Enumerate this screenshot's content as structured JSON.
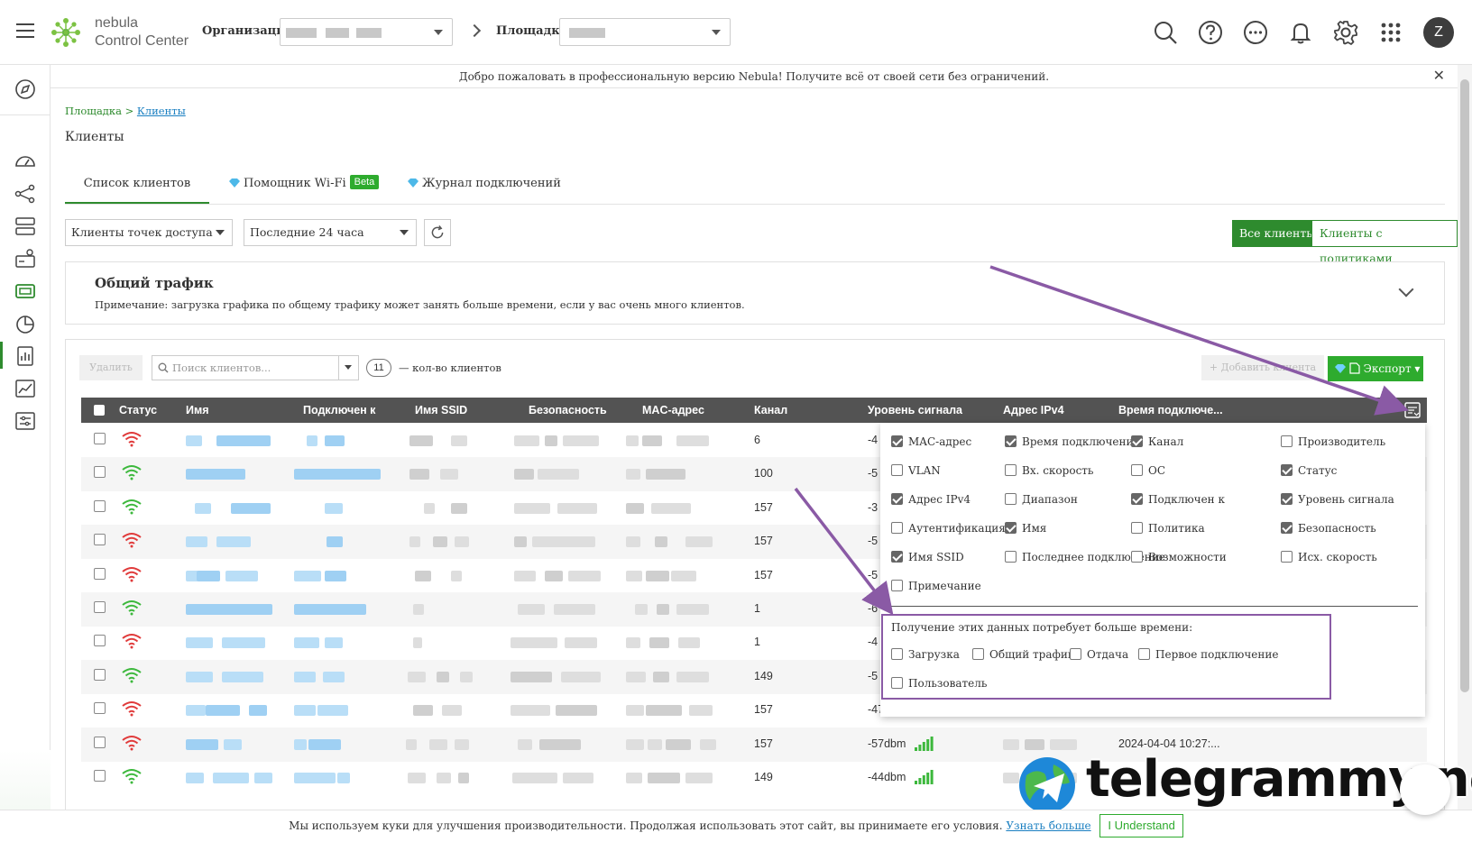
{
  "topbar": {
    "brand_line1": "nebula",
    "brand_line2": "Control Center",
    "org_label": "Организация:",
    "site_label": "Площадка:",
    "icons": [
      "search-icon",
      "help-icon",
      "more-icon",
      "bell-icon",
      "gear-icon",
      "apps-grid-icon"
    ],
    "avatar_letter": "Z"
  },
  "banner": {
    "text": "Добро пожаловать в профессиональную версию Nebula! Получите всё от своей сети без ограничений.",
    "close": "✕"
  },
  "breadcrumb": {
    "root": "Площадка",
    "sep": ">",
    "current": "Клиенты"
  },
  "page_title": "Клиенты",
  "tabs": [
    {
      "label": "Список клиентов"
    },
    {
      "label": "Помощник Wi-Fi",
      "badge": "Beta"
    },
    {
      "label": "Журнал подключений"
    }
  ],
  "filters": {
    "client_type": "Клиенты точек доступа",
    "period": "Последние 24 часа",
    "all_clients": "Все клиенты",
    "policy_clients": "Клиенты с политиками"
  },
  "traffic": {
    "title": "Общий трафик",
    "note": "Примечание: загрузка графика по общему трафику может занять больше времени, если у вас очень много клиентов."
  },
  "toolbar": {
    "delete": "Удалить",
    "search_placeholder": "Поиск клиентов...",
    "count": "11",
    "count_label": "— кол-во клиентов",
    "add": "+ Добавить клиента",
    "export": "Экспорт"
  },
  "table": {
    "columns": [
      "Статус",
      "Имя",
      "Подключен к",
      "Имя SSID",
      "Безопасность",
      "MAC-адрес",
      "Канал",
      "Уровень сигнала",
      "Адрес IPv4",
      "Время подключе..."
    ],
    "rows": [
      {
        "status": "red",
        "channel": "6",
        "signal": "-4"
      },
      {
        "status": "green",
        "channel": "100",
        "signal": "-5"
      },
      {
        "status": "green",
        "channel": "157",
        "signal": "-3"
      },
      {
        "status": "red",
        "channel": "157",
        "signal": "-5"
      },
      {
        "status": "red",
        "channel": "157",
        "signal": "-5"
      },
      {
        "status": "green",
        "channel": "1",
        "signal": "-6"
      },
      {
        "status": "red",
        "channel": "1",
        "signal": "-4"
      },
      {
        "status": "green",
        "channel": "149",
        "signal": "-5"
      },
      {
        "status": "red",
        "channel": "157",
        "signal": "-47dbm"
      },
      {
        "status": "red",
        "channel": "157",
        "signal": "-57dbm",
        "time": "2024-04-04 10:27:..."
      },
      {
        "status": "green",
        "channel": "149",
        "signal": "-44dbm"
      }
    ]
  },
  "column_chooser": {
    "options": [
      {
        "label": "MAC-адрес",
        "checked": true
      },
      {
        "label": "Время подключения",
        "checked": true
      },
      {
        "label": "Канал",
        "checked": true
      },
      {
        "label": "Производитель",
        "checked": false
      },
      {
        "label": "VLAN",
        "checked": false
      },
      {
        "label": "Вх. скорость",
        "checked": false
      },
      {
        "label": "ОС",
        "checked": false
      },
      {
        "label": "Статус",
        "checked": true
      },
      {
        "label": "Адрес IPv4",
        "checked": true
      },
      {
        "label": "Диапазон",
        "checked": false
      },
      {
        "label": "Подключен к",
        "checked": true
      },
      {
        "label": "Уровень сигнала",
        "checked": true
      },
      {
        "label": "Аутентификация",
        "checked": false
      },
      {
        "label": "Имя",
        "checked": true
      },
      {
        "label": "Политика",
        "checked": false
      },
      {
        "label": "Безопасность",
        "checked": true
      },
      {
        "label": "Имя SSID",
        "checked": true
      },
      {
        "label": "Последнее подключение",
        "checked": false
      },
      {
        "label": "Возможности",
        "checked": false
      },
      {
        "label": "Исх. скорость",
        "checked": false
      },
      {
        "label": "Примечание",
        "checked": false
      }
    ],
    "slow_note": "Получение этих данных потребует больше времени:",
    "slow_options": [
      {
        "label": "Загрузка",
        "checked": false
      },
      {
        "label": "Общий трафик",
        "checked": false
      },
      {
        "label": "Отдача",
        "checked": false
      },
      {
        "label": "Первое подключение",
        "checked": false
      },
      {
        "label": "Пользователь",
        "checked": false
      }
    ]
  },
  "watermark": "telegrammy.net",
  "cookie": {
    "text": "Мы используем куки для улучшения производительности. Продолжая использовать этот сайт, вы принимаете его условия.",
    "link": "Узнать больше",
    "button": "I Understand"
  },
  "colors": {
    "accent": "#2eab2e",
    "accent_dark": "#2e8b2e",
    "wifi_red": "#e03a3a",
    "wifi_green": "#3cb83c",
    "annotation": "#8a5aa5"
  }
}
